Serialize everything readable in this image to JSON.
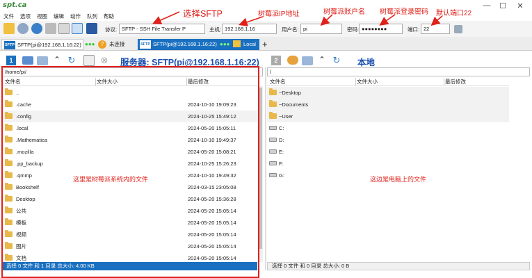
{
  "app": {
    "logo_text": "spt.ca"
  },
  "window_controls": {
    "minimize": "—",
    "maximize": "☐",
    "close": "✕"
  },
  "menu": [
    "文件",
    "选项",
    "视图",
    "编辑",
    "动作",
    "队列",
    "帮助"
  ],
  "toolbar": {
    "protocol_label": "协议:",
    "protocol_value": "SFTP - SSH File Transfer P",
    "host_label": "主机:",
    "host_value": "192.168.1.16",
    "user_label": "用户名:",
    "user_value": "pi",
    "password_label": "密码:",
    "password_value": "●●●●●●●●",
    "port_label": "端口:",
    "port_value": "22"
  },
  "tabs": [
    {
      "label": "SFTP(pi@192.168.1.16:22)",
      "status": "",
      "icon_text": "SFTP"
    },
    {
      "label": "未连接",
      "icon_text": ""
    },
    {
      "label": "SFTP(pi@192.168.1.16:22)",
      "icon_text": "SFTP"
    },
    {
      "label": "Local",
      "icon_text": ""
    }
  ],
  "left_pane": {
    "badge": "1",
    "server_title": "服务器: SFTP(pi@192.168.1.16:22)",
    "path": "/home/pi/",
    "columns": [
      "文件名",
      "文件大小",
      "最后修改"
    ],
    "rows": [
      {
        "name": "..",
        "size": "",
        "modified": ""
      },
      {
        "name": ".cache",
        "size": "",
        "modified": "2024-10-10 19:09:23"
      },
      {
        "name": ".config",
        "size": "",
        "modified": "2024-10-25 15:49:12"
      },
      {
        "name": ".local",
        "size": "",
        "modified": "2024-05-20 15:05:11"
      },
      {
        "name": ".Mathematica",
        "size": "",
        "modified": "2024-10-10 19:49:37"
      },
      {
        "name": ".mozilla",
        "size": "",
        "modified": "2024-05-20 15:08:21"
      },
      {
        "name": ".pp_backup",
        "size": "",
        "modified": "2024-10-25 15:26:23"
      },
      {
        "name": ".qmmp",
        "size": "",
        "modified": "2024-10-10 19:49:32"
      },
      {
        "name": "Bookshelf",
        "size": "",
        "modified": "2024-03-15 23:05:08"
      },
      {
        "name": "Desktop",
        "size": "",
        "modified": "2024-05-20 15:36:28"
      },
      {
        "name": "公共",
        "size": "",
        "modified": "2024-05-20 15:05:14"
      },
      {
        "name": "模板",
        "size": "",
        "modified": "2024-05-20 15:05:14"
      },
      {
        "name": "视频",
        "size": "",
        "modified": "2024-05-20 15:05:14"
      },
      {
        "name": "图片",
        "size": "",
        "modified": "2024-05-20 15:05:14"
      },
      {
        "name": "文档",
        "size": "",
        "modified": "2024-05-20 15:05:14"
      }
    ],
    "status": "选择 0 文件 和 1 目录 总大小: 4.00 KB"
  },
  "right_pane": {
    "badge": "2",
    "local_title": "本地",
    "path": "/",
    "columns": [
      "文件名",
      "文件大小",
      "最后修改"
    ],
    "rows": [
      {
        "name": "~Desktop",
        "type": "folder"
      },
      {
        "name": "~Documents",
        "type": "folder"
      },
      {
        "name": "~User",
        "type": "folder"
      },
      {
        "name": "C:",
        "type": "drive"
      },
      {
        "name": "D:",
        "type": "drive"
      },
      {
        "name": "E:",
        "type": "drive"
      },
      {
        "name": "F:",
        "type": "drive"
      },
      {
        "name": "G:",
        "type": "drive"
      }
    ],
    "status": "选择 0 文件 和 0 目录 总大小: 0 B"
  },
  "annotations": {
    "select_sftp": "选择SFTP",
    "pi_ip": "树莓派IP地址",
    "pi_user": "树莓派账户名",
    "pi_password": "树莓派登录密码",
    "default_port": "默认端口22",
    "left_note": "这里是树莓派系统内的文件",
    "right_note": "这边是电脑上的文件"
  },
  "colors": {
    "accent": "#1a70c0",
    "annotation": "#e0201a",
    "folder": "#e9b84a",
    "status_bar": "#1a70c0"
  }
}
